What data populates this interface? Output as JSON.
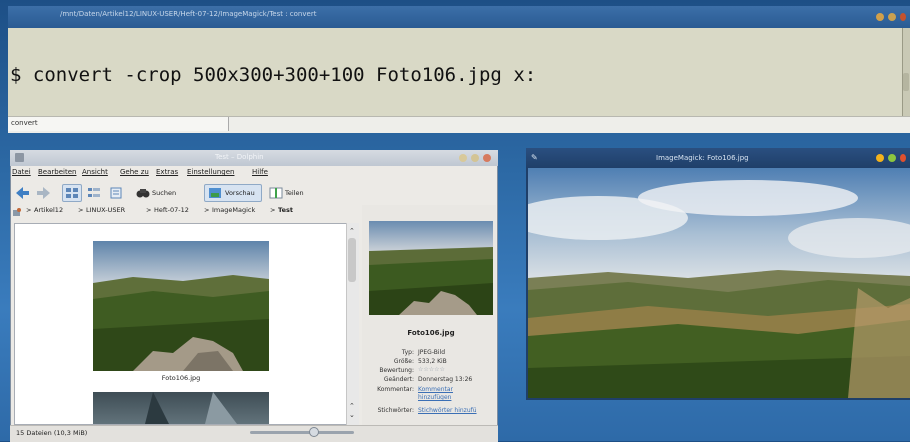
{
  "konsole": {
    "window_title": "/mnt/Daten/Artikel12/LINUX-USER/Heft-07-12/ImageMagick/Test : convert",
    "command": "$ convert -crop 500x300+300+100 Foto106.jpg x:",
    "tab_label": "convert"
  },
  "dolphin": {
    "window_title": "Test – Dolphin",
    "menu": [
      "Datei",
      "Bearbeiten",
      "Ansicht",
      "Gehe zu",
      "Extras",
      "Einstellungen",
      "Hilfe"
    ],
    "toolbar": {
      "search": "Suchen",
      "preview": "Vorschau",
      "split": "Teilen"
    },
    "breadcrumb": [
      "Artikel12",
      "LINUX-USER",
      "Heft-07-12",
      "ImageMagick",
      "Test"
    ],
    "files": [
      {
        "name": "Foto106.jpg"
      }
    ],
    "info_panel": {
      "file_name": "Foto106.jpg",
      "rows": [
        {
          "label": "Typ:",
          "value": "JPEG-Bild"
        },
        {
          "label": "Größe:",
          "value": "533,2 KiB"
        },
        {
          "label": "Bewertung:",
          "value": "☆☆☆☆☆"
        },
        {
          "label": "Geändert:",
          "value": "Donnerstag 13:26"
        },
        {
          "label": "Kommentar:",
          "value": "Kommentar hinzufügen"
        },
        {
          "label": "Stichwörter:",
          "value": "Stichwörter hinzufü"
        }
      ]
    },
    "status": "15 Dateien (10,3 MiB)",
    "zoom_level": 0.62
  },
  "imagemagick": {
    "window_title": "ImageMagick: Foto106.jpg"
  },
  "colors": {
    "desktop": "#2d6aa6",
    "terminal_bg": "#d9d9c6",
    "close_button": "#e0502e",
    "min_button": "#f2b21d",
    "max_button": "#8cc63f"
  }
}
